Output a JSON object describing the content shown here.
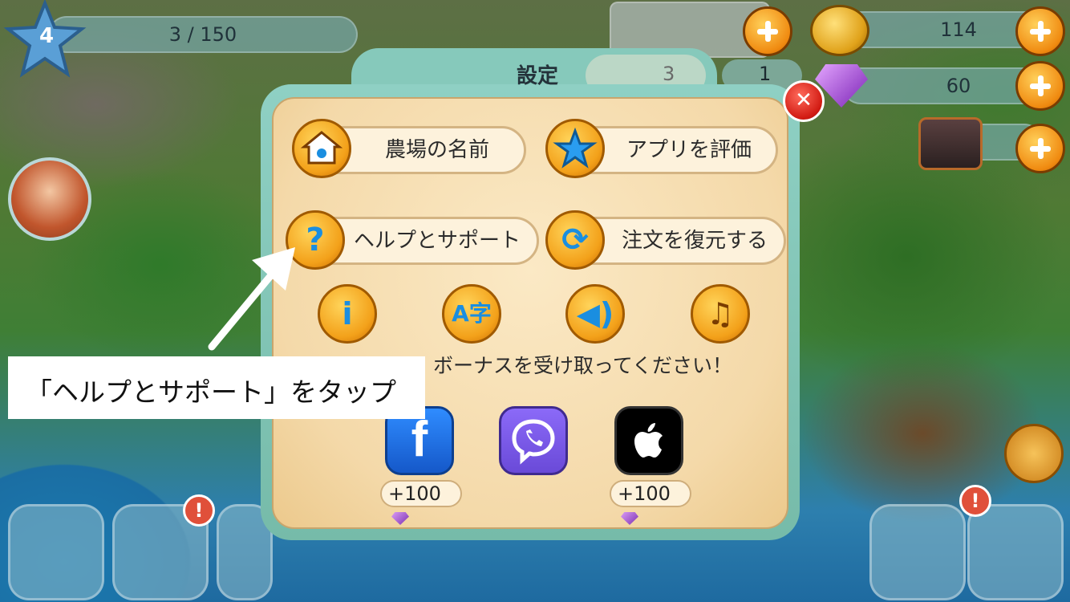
{
  "hud": {
    "level": "4",
    "xp_progress": "3 / 150",
    "cards_count": "1",
    "card_tab_count": "3",
    "coins": "114",
    "gems": "60"
  },
  "dialog": {
    "title": "設定",
    "close_icon": "close-icon",
    "buttons": {
      "farm_name": "農場の名前",
      "rate_app": "アプリを評価",
      "help_support": "ヘルプとサポート",
      "restore_orders": "注文を復元する"
    },
    "icon_row": [
      "info-icon",
      "language-icon",
      "sound-icon",
      "music-icon"
    ],
    "bonus_text": "ボーナスを受け取ってください！",
    "social": {
      "facebook_reward": "+100",
      "apple_reward": "+100"
    }
  },
  "callout": {
    "text": "「ヘルプとサポート」をタップ"
  },
  "colors": {
    "accent_orange": "#f3a11a",
    "panel_teal": "#86c9bb",
    "panel_cream": "#f4d9a9",
    "close_red": "#d11a12",
    "facebook_blue": "#1877f2",
    "viber_purple": "#7360f2",
    "apple_black": "#000000"
  }
}
